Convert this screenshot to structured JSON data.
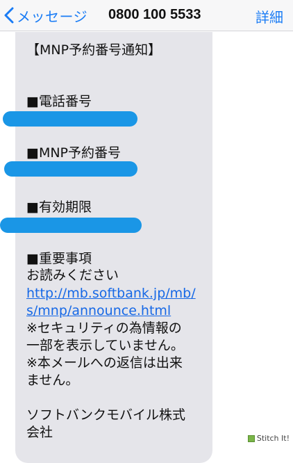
{
  "navbar": {
    "back_label": "メッセージ",
    "title": "0800 100 5533",
    "details_label": "詳細"
  },
  "message": {
    "heading": "【MNP予約番号通知】",
    "section_phone": "■電話番号",
    "section_mnp": "■MNP予約番号",
    "section_expiry": "■有効期限",
    "section_important": "■重要事項",
    "read_please": "お読みください",
    "link_line1": "http://mb.softbank.jp/mb/",
    "link_line2": "s/mnp/announce.html",
    "note1_line1": "※セキュリティの為情報の",
    "note1_line2": "一部を表示していません。",
    "note2_line1": "※本メールへの返信は出来",
    "note2_line2": "ません。",
    "signature_line1": "ソフトバンクモバイル株式",
    "signature_line2": "会社"
  },
  "watermark": {
    "text": "Stitch It!"
  },
  "colors": {
    "accent": "#1a7cf5",
    "bubble": "#e5e5ea",
    "redaction": "#1a96e6"
  }
}
